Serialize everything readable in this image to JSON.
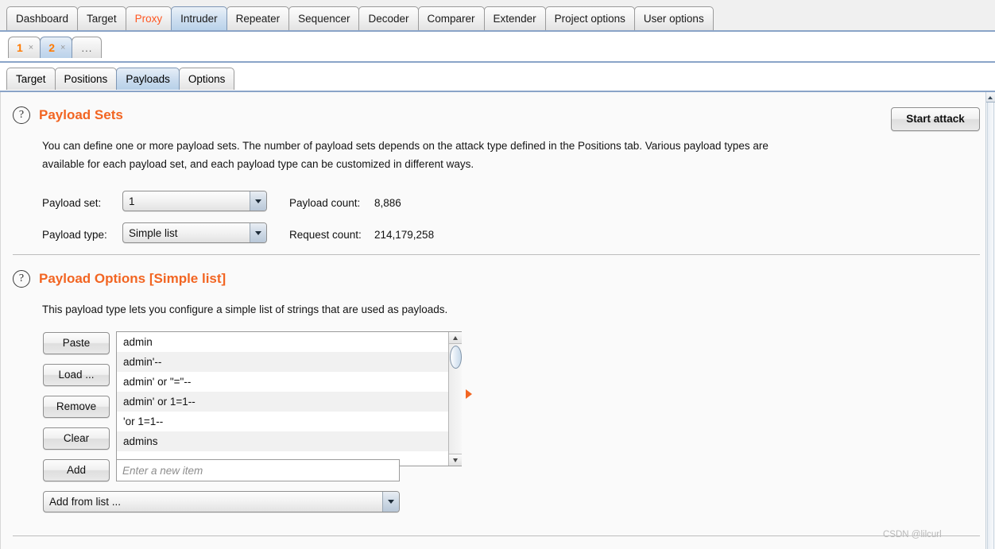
{
  "main_tabs": [
    {
      "label": "Dashboard",
      "state": "normal"
    },
    {
      "label": "Target",
      "state": "normal"
    },
    {
      "label": "Proxy",
      "state": "highlight"
    },
    {
      "label": "Intruder",
      "state": "selected"
    },
    {
      "label": "Repeater",
      "state": "normal"
    },
    {
      "label": "Sequencer",
      "state": "normal"
    },
    {
      "label": "Decoder",
      "state": "normal"
    },
    {
      "label": "Comparer",
      "state": "normal"
    },
    {
      "label": "Extender",
      "state": "normal"
    },
    {
      "label": "Project options",
      "state": "normal"
    },
    {
      "label": "User options",
      "state": "normal"
    }
  ],
  "attack_tabs": [
    {
      "label": "1",
      "close": "×",
      "state": "normal"
    },
    {
      "label": "2",
      "close": "×",
      "state": "selected"
    },
    {
      "label": "...",
      "close": "",
      "state": "more"
    }
  ],
  "sub_tabs": [
    {
      "label": "Target",
      "state": "normal"
    },
    {
      "label": "Positions",
      "state": "normal"
    },
    {
      "label": "Payloads",
      "state": "selected"
    },
    {
      "label": "Options",
      "state": "normal"
    }
  ],
  "payload_sets": {
    "help_icon": "?",
    "title": "Payload Sets",
    "description_line1": "You can define one or more payload sets. The number of payload sets depends on the attack type defined in the Positions tab. Various payload types are",
    "description_line2": "available for each payload set, and each payload type can be customized in different ways.",
    "payload_set_label": "Payload set:",
    "payload_set_value": "1",
    "payload_type_label": "Payload type:",
    "payload_type_value": "Simple list",
    "payload_count_label": "Payload count:",
    "payload_count_value": "8,886",
    "request_count_label": "Request count:",
    "request_count_value": "214,179,258"
  },
  "start_attack_label": "Start attack",
  "payload_options": {
    "help_icon": "?",
    "title": "Payload Options [Simple list]",
    "description": "This payload type lets you configure a simple list of strings that are used as payloads.",
    "buttons": [
      {
        "label": "Paste"
      },
      {
        "label": "Load ..."
      },
      {
        "label": "Remove"
      },
      {
        "label": "Clear"
      }
    ],
    "add_button_label": "Add",
    "add_input_placeholder": "Enter a new item",
    "add_from_list_label": "Add from list ...",
    "items": [
      "admin",
      "admin'--",
      "admin' or \"=\"--",
      "admin' or 1=1--",
      "'or 1=1--",
      "admins"
    ]
  },
  "watermark": "CSDN @lilcurl",
  "colors": {
    "accent_orange": "#f26522",
    "tab_selected_blue": "#bad2ea",
    "panel_bg": "#fafafa"
  }
}
